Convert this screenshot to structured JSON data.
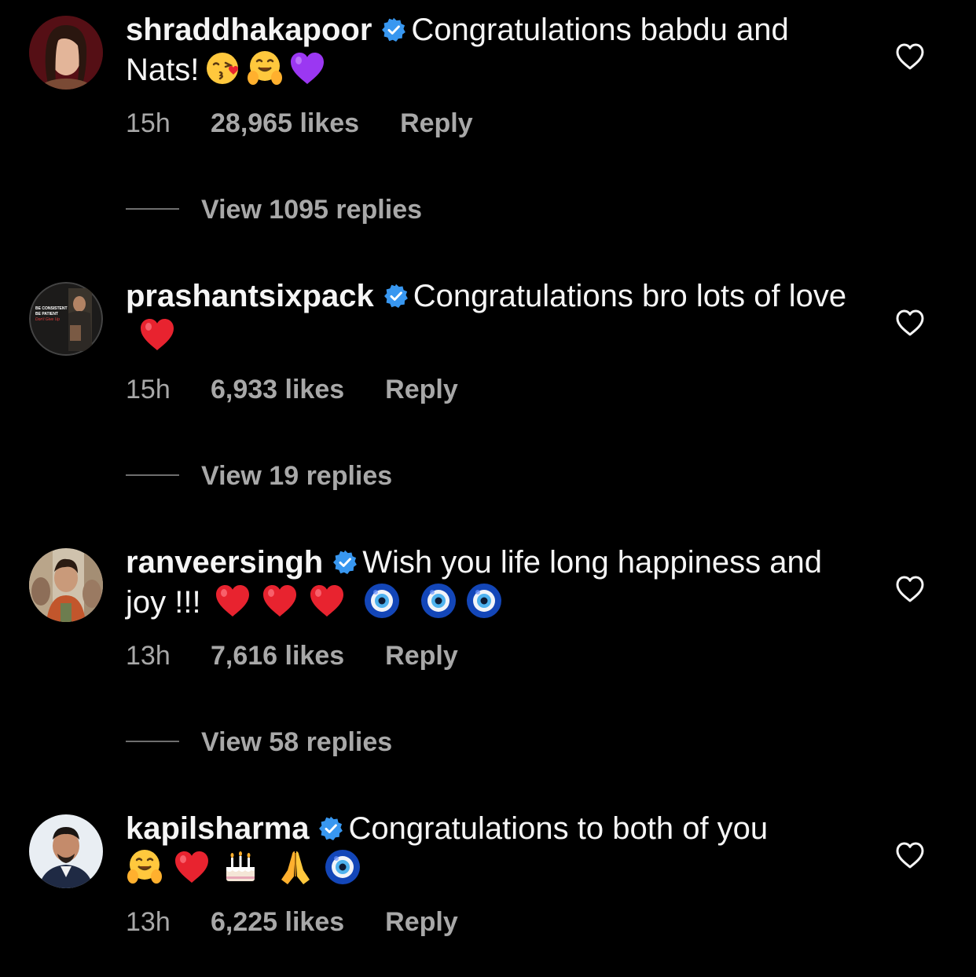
{
  "comments": [
    {
      "username": "shraddhakapoor",
      "text": "Congratulations babdu and Nats!",
      "emojis": [
        "kiss-emoji",
        "hug-emoji",
        "purple-heart-emoji"
      ],
      "time": "15h",
      "likes": "28,965 likes",
      "reply": "Reply",
      "view_replies": "View 1095 replies"
    },
    {
      "username": "prashantsixpack",
      "text": "Congratulations bro lots of love",
      "emojis": [
        "red-heart-emoji"
      ],
      "avatar_text": [
        "BE CONSISTENT",
        "BE PATIENT",
        "Don't Give Up"
      ],
      "time": "15h",
      "likes": "6,933 likes",
      "reply": "Reply",
      "view_replies": "View 19 replies"
    },
    {
      "username": "ranveersingh",
      "text": "Wish you life long happiness and joy !!!",
      "emojis": [
        "red-heart-emoji",
        "red-heart-emoji",
        "red-heart-emoji",
        "nazar-emoji",
        "nazar-emoji",
        "nazar-emoji"
      ],
      "time": "13h",
      "likes": "7,616 likes",
      "reply": "Reply",
      "view_replies": "View 58 replies"
    },
    {
      "username": "kapilsharma",
      "text": "Congratulations to both of you",
      "emojis": [
        "hug-emoji",
        "red-heart-emoji",
        "cake-emoji",
        "folded-hands-emoji",
        "nazar-emoji"
      ],
      "time": "13h",
      "likes": "6,225 likes",
      "reply": "Reply"
    }
  ],
  "colors": {
    "background": "#000000",
    "text": "#f5f5f5",
    "muted": "#a8a8a8",
    "verified": "#3897f0"
  }
}
